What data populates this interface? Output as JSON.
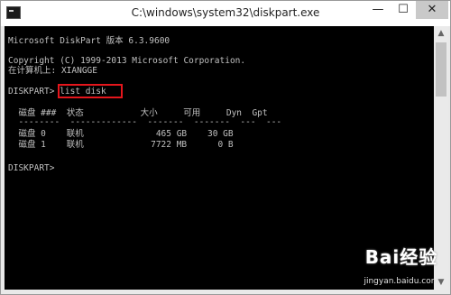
{
  "window": {
    "title": "C:\\windows\\system32\\diskpart.exe",
    "minimize_label": "—",
    "maximize_label": "☐",
    "close_label": "✕"
  },
  "console": {
    "lines": [
      "Microsoft DiskPart 版本 6.3.9600",
      "",
      "Copyright (C) 1999-2013 Microsoft Corporation.",
      "在计算机上: XIANGGE",
      "",
      "DISKPART> list disk",
      "",
      "  磁盘 ###  状态           大小     可用     Dyn  Gpt",
      "  --------  -------------  -------  -------  ---  ---",
      "  磁盘 0    联机              465 GB    30 GB",
      "  磁盘 1    联机             7722 MB      0 B",
      "",
      "DISKPART>"
    ]
  },
  "scrollbar": {
    "up_icon": "▲",
    "down_icon": "▼"
  },
  "watermark": {
    "logo": "Bai经验",
    "url": "jingyan.baidu.com"
  }
}
